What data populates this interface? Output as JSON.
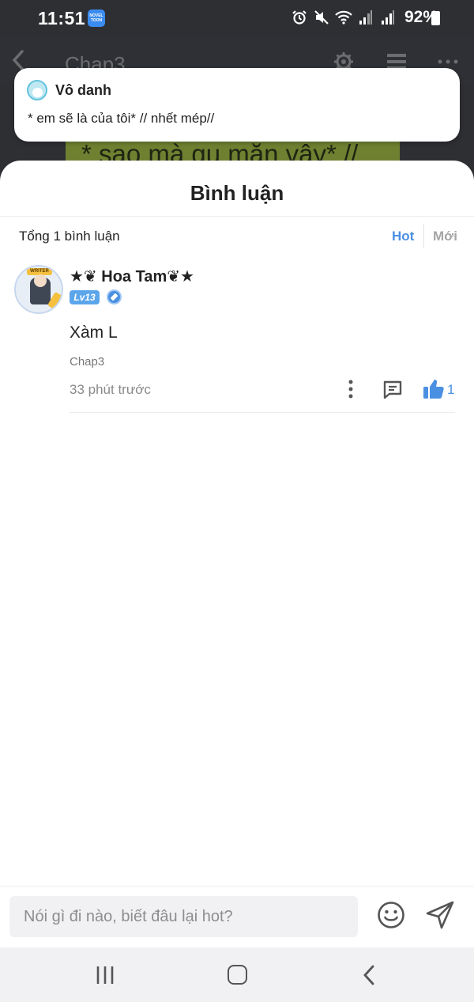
{
  "status_bar": {
    "time": "11:51",
    "app_badge": "NOVEL TOON",
    "battery_percent": "92%",
    "icons": [
      "alarm-icon",
      "mute-icon",
      "wifi-icon",
      "signal-icon",
      "signal-icon-2",
      "battery-icon"
    ]
  },
  "reader": {
    "chapter_title": "Chap3",
    "icons": [
      "back-arrow-icon",
      "gear-icon",
      "list-icon",
      "more-horizontal-icon"
    ],
    "background_text": "* sao mà gu mặn vậy* //"
  },
  "notification": {
    "name": "Vô danh",
    "text": "* em sẽ là của tôi* // nhết mép//"
  },
  "comments_sheet": {
    "title": "Bình luận",
    "total": "Tổng 1 bình luận",
    "sort": {
      "hot": "Hot",
      "new": "Mới",
      "active": "hot"
    },
    "comments": [
      {
        "author": "★❦ Hoa Tam❦★",
        "avatar_tag": "WRITER",
        "level": "Lv13",
        "body": "Xàm L",
        "chapter": "Chap3",
        "time": "33 phút trước",
        "likes": "1"
      }
    ]
  },
  "composer": {
    "placeholder": "Nói gì đi nào, biết đâu lại hot?"
  },
  "colors": {
    "accent": "#4a90e2",
    "level_badge": "#5ba5ea",
    "inactive_sort": "#a5a5a5"
  }
}
